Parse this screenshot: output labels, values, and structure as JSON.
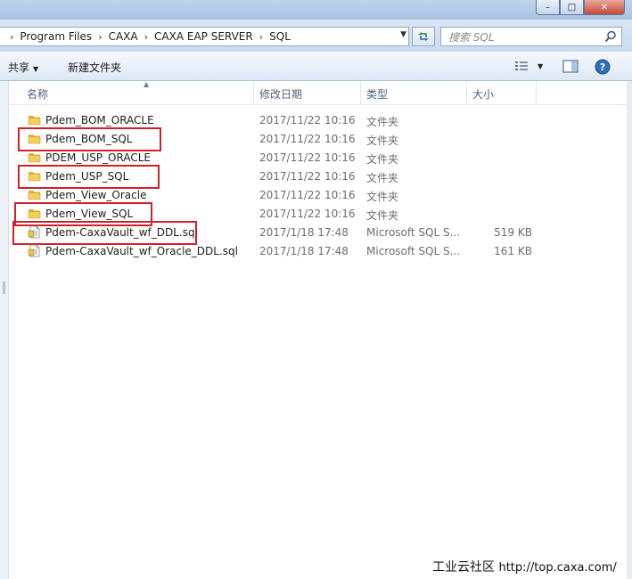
{
  "window": {
    "minimize_glyph": "–",
    "maximize_glyph": "□",
    "close_glyph": "✕"
  },
  "address": {
    "crumbs": [
      "Program Files",
      "CAXA",
      "CAXA EAP SERVER",
      "SQL"
    ],
    "separator": "›"
  },
  "search": {
    "placeholder": "搜索 SQL"
  },
  "toolbar": {
    "share": "共享",
    "new_folder": "新建文件夹"
  },
  "columns": {
    "name": "名称",
    "date": "修改日期",
    "type": "类型",
    "size": "大小"
  },
  "files": [
    {
      "name": "Pdem_BOM_ORACLE",
      "date": "2017/11/22 10:16",
      "type": "文件夹",
      "size": "",
      "icon": "folder-icon",
      "highlighted": false
    },
    {
      "name": "Pdem_BOM_SQL",
      "date": "2017/11/22 10:16",
      "type": "文件夹",
      "size": "",
      "icon": "folder-icon",
      "highlighted": true
    },
    {
      "name": "PDEM_USP_ORACLE",
      "date": "2017/11/22 10:16",
      "type": "文件夹",
      "size": "",
      "icon": "folder-icon",
      "highlighted": false
    },
    {
      "name": "Pdem_USP_SQL",
      "date": "2017/11/22 10:16",
      "type": "文件夹",
      "size": "",
      "icon": "folder-icon",
      "highlighted": true
    },
    {
      "name": "Pdem_View_Oracle",
      "date": "2017/11/22 10:16",
      "type": "文件夹",
      "size": "",
      "icon": "folder-icon",
      "highlighted": false
    },
    {
      "name": "Pdem_View_SQL",
      "date": "2017/11/22 10:16",
      "type": "文件夹",
      "size": "",
      "icon": "folder-icon",
      "highlighted": true
    },
    {
      "name": "Pdem-CaxaVault_wf_DDL.sql",
      "date": "2017/1/18 17:48",
      "type": "Microsoft SQL S...",
      "size": "519 KB",
      "icon": "sql-file-icon",
      "highlighted": true
    },
    {
      "name": "Pdem-CaxaVault_wf_Oracle_DDL.sql",
      "date": "2017/1/18 17:48",
      "type": "Microsoft SQL S...",
      "size": "161 KB",
      "icon": "sql-file-icon",
      "highlighted": false
    }
  ],
  "watermark": {
    "brand": "工业云社区",
    "url": "http://top.caxa.com/"
  },
  "colors": {
    "highlight": "#d0202a",
    "folder": "#e8b838"
  }
}
